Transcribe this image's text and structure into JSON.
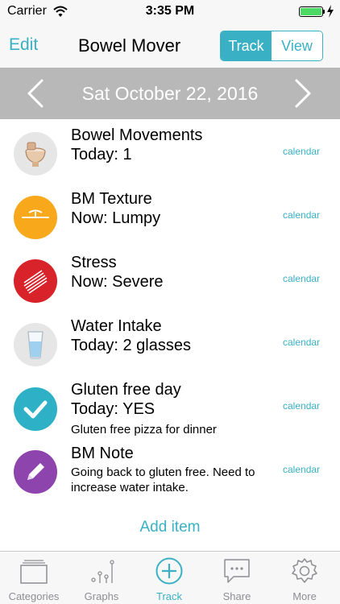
{
  "status": {
    "carrier": "Carrier",
    "time": "3:35 PM",
    "battery_level": 1.0
  },
  "nav": {
    "edit": "Edit",
    "title": "Bowel Mover",
    "segments": [
      "Track",
      "View"
    ],
    "selected_segment": "Track"
  },
  "date_bar": {
    "date": "Sat October 22, 2016"
  },
  "items": [
    {
      "name": "Bowel Movements",
      "value": "Today: 1",
      "calendar": "calendar",
      "icon": "toilet-icon",
      "color": "#e6e6e6"
    },
    {
      "name": "BM Texture",
      "value": "Now: Lumpy",
      "calendar": "calendar",
      "icon": "texture-icon",
      "color": "#f7a81b"
    },
    {
      "name": "Stress",
      "value": "Now: Severe",
      "calendar": "calendar",
      "icon": "stress-icon",
      "color": "#d8232a"
    },
    {
      "name": "Water Intake",
      "value": "Today: 2 glasses",
      "calendar": "calendar",
      "icon": "water-glass-icon",
      "color": "#e6e6e6"
    },
    {
      "name": "Gluten free day",
      "value": "Today: YES",
      "note": "Gluten free pizza for dinner",
      "calendar": "calendar",
      "icon": "checkmark-icon",
      "color": "#2eb1c6"
    },
    {
      "name": "BM Note",
      "note_line1": "Going back to gluten free. Need to",
      "note_line2": "increase water intake.",
      "calendar": "calendar",
      "icon": "pencil-icon",
      "color": "#8e44ad"
    }
  ],
  "add_item": "Add item",
  "tabs": [
    {
      "label": "Categories",
      "icon": "categories-icon"
    },
    {
      "label": "Graphs",
      "icon": "graphs-icon"
    },
    {
      "label": "Track",
      "icon": "add-circle-icon"
    },
    {
      "label": "Share",
      "icon": "share-message-icon"
    },
    {
      "label": "More",
      "icon": "gear-icon"
    }
  ],
  "active_tab": "Track",
  "colors": {
    "accent": "#3ab0c4",
    "date_bar": "#b8b8b8",
    "bar_background": "#f7f7f7",
    "inactive_tab": "#8e8e93"
  }
}
